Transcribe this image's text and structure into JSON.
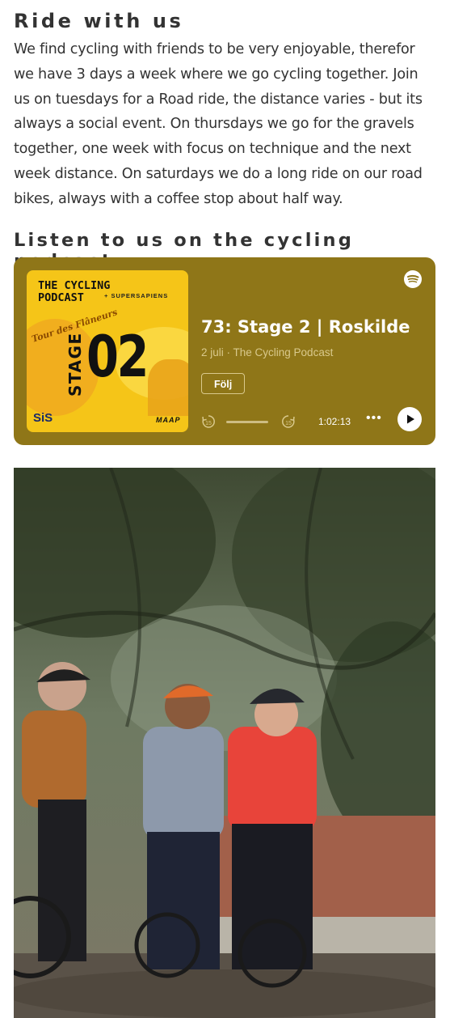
{
  "ride": {
    "heading": "Ride with us",
    "text": "We find cycling with friends to be very enjoyable, therefor we have 3 days a week where we go cycling together. Join us on tuesdays for a Road ride, the distance varies - but its always a social event. On thursdays we go for the gravels together, one week with focus on technique and the next week distance. On saturdays we do a long ride on our road bikes, always with a coffee stop about half way."
  },
  "podcast": {
    "heading": "Listen to us on the cycling podcast",
    "episode_title": "73: Stage 2 | Roskilde",
    "episode_meta": "2 juli · The Cycling Podcast",
    "follow_label": "Följ",
    "duration": "1:02:13",
    "more_label": "•••",
    "accent": "#8f7618",
    "artwork": {
      "title_line1": "THE CYCLING",
      "title_line2": "PODCAST",
      "partner": "+ SUPERSAPIENS",
      "script": "Tour des Flâneurs",
      "stage_word": "STAGE",
      "stage_number": "02",
      "sponsor_left": "SiS",
      "sponsor_right": "MAAP"
    },
    "skip_back_label": "15",
    "skip_forward_label": "15"
  },
  "photo": {
    "subject": "Three cyclists with bikes on a leafy path"
  }
}
